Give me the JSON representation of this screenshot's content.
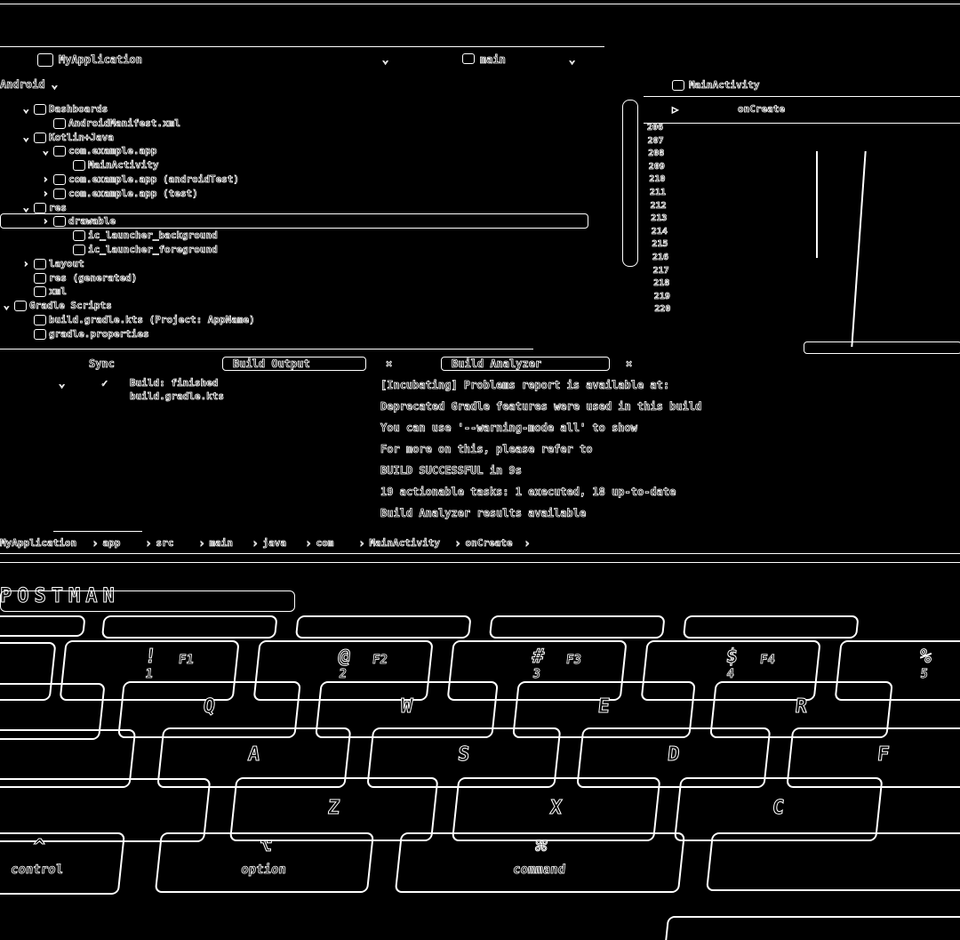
{
  "ide": {
    "branch_label": "main",
    "tree": [
      {
        "label": "Dashboards",
        "indent": 1,
        "chevron": "down"
      },
      {
        "label": "AndroidManifest.xml",
        "indent": 2,
        "chevron": ""
      },
      {
        "label": "Kotlin+Java",
        "indent": 1,
        "chevron": "down"
      },
      {
        "label": "com.example.app",
        "indent": 2,
        "chevron": "down"
      },
      {
        "label": "MainActivity",
        "indent": 3,
        "chevron": ""
      },
      {
        "label": "com.example.app (androidTest)",
        "indent": 2,
        "chevron": "right"
      },
      {
        "label": "com.example.app (test)",
        "indent": 2,
        "chevron": "right"
      },
      {
        "label": "res",
        "indent": 1,
        "chevron": "down",
        "selected": true
      },
      {
        "label": "drawable",
        "indent": 2,
        "chevron": "right"
      },
      {
        "label": "ic_launcher_background",
        "indent": 3,
        "chevron": ""
      },
      {
        "label": "ic_launcher_foreground",
        "indent": 3,
        "chevron": ""
      },
      {
        "label": "layout",
        "indent": 1,
        "chevron": "right"
      },
      {
        "label": "res (generated)",
        "indent": 1,
        "chevron": ""
      },
      {
        "label": "xml",
        "indent": 1,
        "chevron": ""
      },
      {
        "label": "Gradle Scripts",
        "indent": 0,
        "chevron": "down"
      },
      {
        "label": "build.gradle.kts (Project: AppName)",
        "indent": 1,
        "chevron": ""
      },
      {
        "label": "gradle.properties",
        "indent": 1,
        "chevron": ""
      }
    ],
    "line_numbers": [
      "206",
      "207",
      "208",
      "209",
      "210",
      "211",
      "212",
      "213",
      "214",
      "215",
      "216",
      "217",
      "218",
      "219",
      "220"
    ],
    "bottom_tabs": [
      "Sync",
      "Build Output",
      "Build Analyzer"
    ],
    "build_tree": [
      "Build: finished",
      "build.gradle.kts"
    ],
    "console_lines": [
      "[Incubating] Problems report is available at:",
      "Deprecated Gradle features were used in this build",
      "You can use '--warning-mode all' to show",
      "For more on this, please refer to",
      "BUILD SUCCESSFUL in 9s",
      "19 actionable tasks: 1 executed, 18 up-to-date",
      "Build Analyzer results available"
    ],
    "breadcrumb": [
      "MyApplication",
      "app",
      "src",
      "main",
      "java",
      "com",
      "MainActivity",
      "onCreate"
    ]
  },
  "keyboard": {
    "brand": "POSTMAN",
    "fn_row": [
      "F1",
      "F2",
      "F3",
      "F4"
    ],
    "num_row": [
      {
        "top": "!",
        "bottom": "1"
      },
      {
        "top": "@",
        "bottom": "2"
      },
      {
        "top": "#",
        "bottom": "3"
      },
      {
        "top": "$",
        "bottom": "4"
      },
      {
        "top": "%",
        "bottom": "5"
      }
    ],
    "qwerty_row": [
      "Q",
      "W",
      "E",
      "R"
    ],
    "home_row": [
      "A",
      "S",
      "D",
      "F"
    ],
    "bottom_letters": [
      "Z",
      "X",
      "C"
    ],
    "modifiers": [
      {
        "symbol": "^",
        "label": "control"
      },
      {
        "symbol": "⌥",
        "label": "option"
      },
      {
        "symbol": "⌘",
        "label": "command"
      }
    ]
  }
}
